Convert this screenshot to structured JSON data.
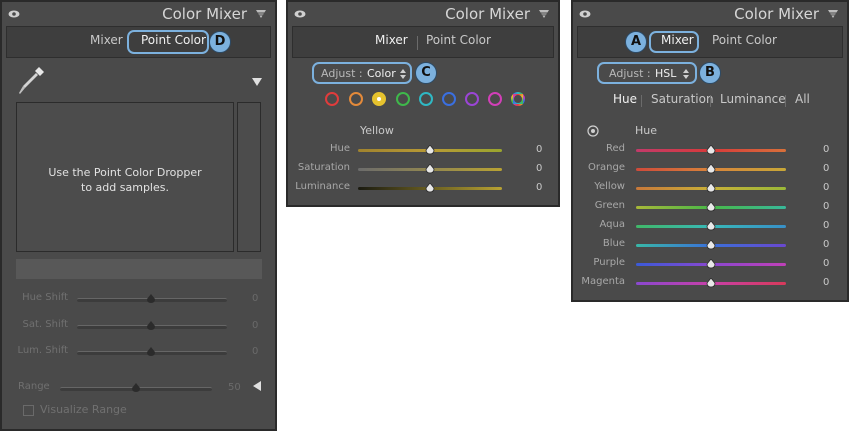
{
  "panel_title": "Color Mixer",
  "panel1": {
    "tabs": [
      "Mixer",
      "Point Color"
    ],
    "badge": "D",
    "empty_message": "Use the Point Color Dropper to add samples.",
    "sliders": [
      {
        "label": "Hue Shift",
        "value": "0"
      },
      {
        "label": "Sat. Shift",
        "value": "0"
      },
      {
        "label": "Lum. Shift",
        "value": "0"
      }
    ],
    "range": {
      "label": "Range",
      "value": "50"
    },
    "visualize_label": "Visualize Range"
  },
  "panel2": {
    "tabs": [
      "Mixer",
      "Point Color"
    ],
    "adjust": {
      "label": "Adjust :",
      "value": "Color"
    },
    "badge": "C",
    "swatch_colors": [
      "#e03c3c",
      "#e48a3a",
      "#e6c22e",
      "#3fb84b",
      "#2fb8c4",
      "#3a6fe0",
      "#9b45d6",
      "#d23fb8"
    ],
    "selected_color": "Yellow",
    "sliders": [
      {
        "label": "Hue",
        "value": "0"
      },
      {
        "label": "Saturation",
        "value": "0"
      },
      {
        "label": "Luminance",
        "value": "0"
      }
    ]
  },
  "panel3": {
    "tabs": [
      "Mixer",
      "Point Color"
    ],
    "badge_a": "A",
    "badge_b": "B",
    "adjust": {
      "label": "Adjust :",
      "value": "HSL"
    },
    "subtabs": [
      "Hue",
      "Saturation",
      "Luminance",
      "All"
    ],
    "section_label": "Hue",
    "sliders": [
      {
        "label": "Red",
        "value": "0"
      },
      {
        "label": "Orange",
        "value": "0"
      },
      {
        "label": "Yellow",
        "value": "0"
      },
      {
        "label": "Green",
        "value": "0"
      },
      {
        "label": "Aqua",
        "value": "0"
      },
      {
        "label": "Blue",
        "value": "0"
      },
      {
        "label": "Purple",
        "value": "0"
      },
      {
        "label": "Magenta",
        "value": "0"
      }
    ]
  },
  "accent_color": "#7cb1de"
}
